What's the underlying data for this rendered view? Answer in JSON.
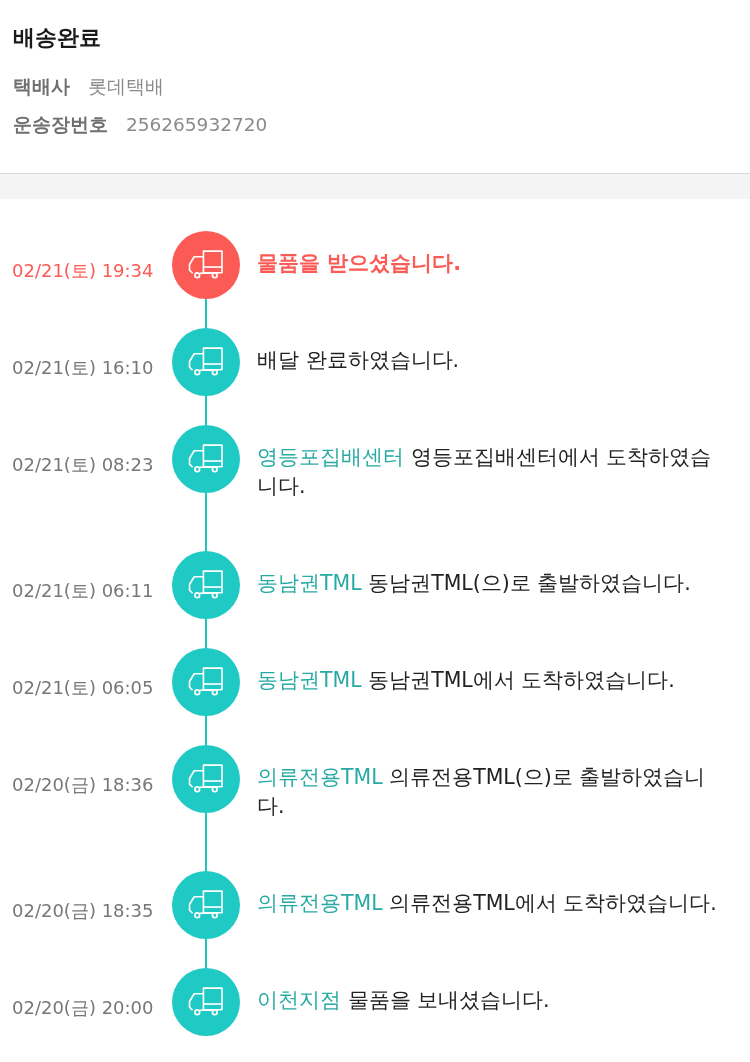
{
  "header": {
    "title": "배송완료",
    "fields": [
      {
        "label": "택배사",
        "value": "롯데택배"
      },
      {
        "label": "운송장번호",
        "value": "256265932720"
      }
    ]
  },
  "timeline": [
    {
      "time": "02/21(토) 19:34",
      "message": "물품을 받으셨습니다.",
      "current": true
    },
    {
      "time": "02/21(토) 16:10",
      "message": "배달 완료하였습니다.",
      "current": false
    },
    {
      "time": "02/21(토) 08:23",
      "location": "영등포집배센터",
      "message": "영등포집배센터에서 도착하였습니다.",
      "current": false
    },
    {
      "time": "02/21(토) 06:11",
      "location": "동남권TML",
      "message": "동남권TML(으)로 출발하였습니다.",
      "current": false
    },
    {
      "time": "02/21(토) 06:05",
      "location": "동남권TML",
      "message": "동남권TML에서 도착하였습니다.",
      "current": false
    },
    {
      "time": "02/20(금) 18:36",
      "location": "의류전용TML",
      "message": "의류전용TML(으)로 출발하였습니다.",
      "current": false
    },
    {
      "time": "02/20(금) 18:35",
      "location": "의류전용TML",
      "message": "의류전용TML에서 도착하였습니다.",
      "current": false
    },
    {
      "time": "02/20(금) 20:00",
      "location": "이천지점",
      "message": "물품을 보내셨습니다.",
      "current": false
    }
  ]
}
